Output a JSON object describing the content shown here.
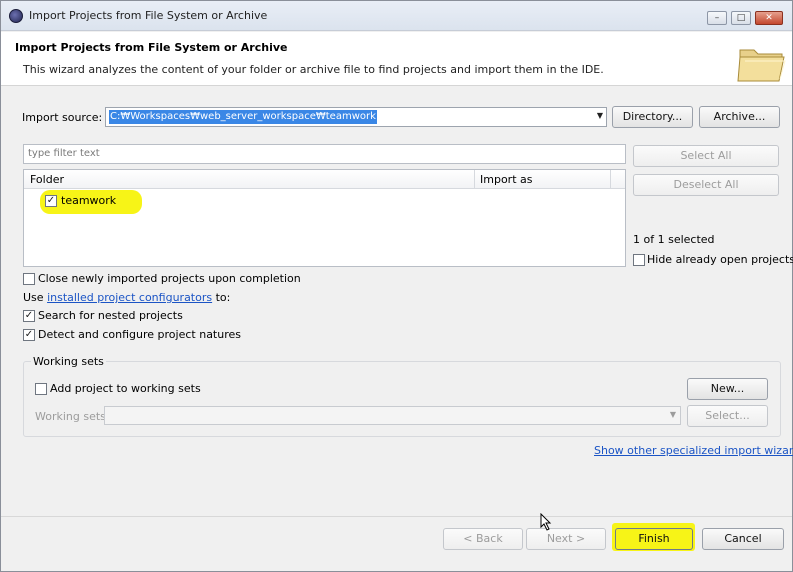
{
  "window": {
    "title": "Import Projects from File System or Archive"
  },
  "header": {
    "title": "Import Projects from File System or Archive",
    "description": "This wizard analyzes the content of your folder or archive file to find projects and import them in the IDE."
  },
  "import_source": {
    "label": "Import source:",
    "value": "C:₩Workspaces₩web_server_workspace₩teamwork",
    "directory_button": "Directory...",
    "archive_button": "Archive..."
  },
  "filter": {
    "placeholder": "type filter text"
  },
  "table": {
    "columns": [
      "Folder",
      "Import as"
    ],
    "rows": [
      {
        "folder": "teamwork",
        "import_as": "",
        "checked": true
      }
    ]
  },
  "selection": {
    "select_all": "Select All",
    "deselect_all": "Deselect All",
    "count_text": "1 of 1 selected",
    "hide_open_label": "Hide already open projects"
  },
  "options": {
    "close_after_import": "Close newly imported projects upon completion",
    "use_prefix": "Use",
    "configurators_link": "installed project configurators",
    "use_suffix": "to:",
    "search_nested": "Search for nested projects",
    "detect_natures": "Detect and configure project natures"
  },
  "working_sets": {
    "group_title": "Working sets",
    "add_label": "Add project to working sets",
    "new_button": "New...",
    "sets_label": "Working sets",
    "select_button": "Select..."
  },
  "other_wizards_link": "Show other specialized import wizards",
  "footer": {
    "back": "< Back",
    "next": "Next >",
    "finish": "Finish",
    "cancel": "Cancel"
  },
  "colors": {
    "highlight": "#f7f417",
    "selection": "#3a87e6",
    "link": "#1b54c5"
  }
}
